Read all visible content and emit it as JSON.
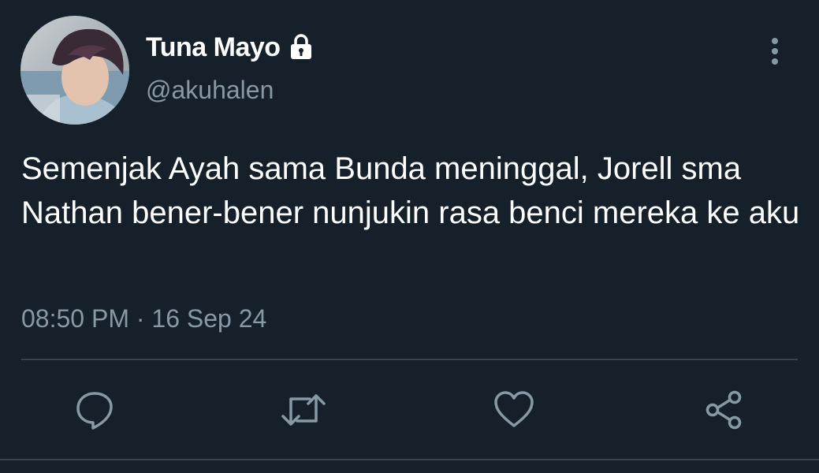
{
  "user": {
    "display_name": "Tuna Mayo",
    "handle": "@akuhalen",
    "protected_icon": "lock-icon"
  },
  "tweet": {
    "text": "Semenjak Ayah sama Bunda meninggal, Jorell sma Nathan bener-bener nunjukin rasa benci mereka ke aku",
    "time": "08:50 PM",
    "separator": "·",
    "date": "16 Sep 24"
  },
  "actions": [
    {
      "name": "reply",
      "icon": "reply-icon"
    },
    {
      "name": "retweet",
      "icon": "retweet-icon"
    },
    {
      "name": "like",
      "icon": "heart-icon"
    },
    {
      "name": "share",
      "icon": "share-icon"
    }
  ],
  "menu": {
    "icon": "more-vertical-icon"
  },
  "colors": {
    "background": "#15202b",
    "primary_text": "#ffffff",
    "secondary_text": "#8899a6",
    "divider": "#38444d",
    "icon": "#8899a6"
  }
}
